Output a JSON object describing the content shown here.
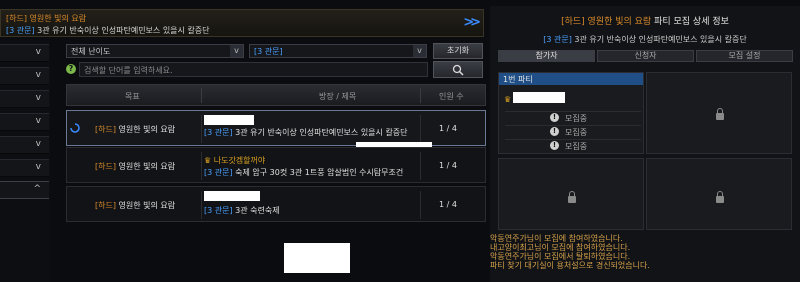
{
  "banner": {
    "difficulty": "[하드]",
    "dungeon": "영원한 빛의 요람",
    "tag": "[3 관문]",
    "description": "3관 유기 반숙이상 인성파탄예민보스 있을시 칼증단"
  },
  "filters": {
    "difficulty_select": "전체 난이도",
    "gate_select": "[3 관문]",
    "reset_button": "초기화",
    "search_placeholder": "검색할 단어를 입력하세요."
  },
  "list": {
    "columns": [
      "목표",
      "방장 / 제목",
      "인원 수"
    ],
    "rows": [
      {
        "difficulty": "[하드]",
        "target": "영원한 빛의 요람",
        "leader": "",
        "tag": "[3 관문]",
        "title": "3관 유기 반숙이상 인성파탄예민보스 있을시 칼증단",
        "count": "1 / 4"
      },
      {
        "difficulty": "[하드]",
        "target": "영원한 빛의 요람",
        "leader": "나도갓겜할꺼야",
        "tag": "[3 관문]",
        "title": "숙제 암구 30컷 3관 1트풍 암살범인 수시탐무조건",
        "count": "1 / 4"
      },
      {
        "difficulty": "[하드]",
        "target": "영원한 빛의 요람",
        "leader": "",
        "tag": "[3 관문]",
        "title": "3관 숙련숙제",
        "count": "1 / 4"
      }
    ]
  },
  "panel": {
    "title_hl": "[하드] 영원한 빛의 요람",
    "title_rest": "파티 모집 상세 정보",
    "sub_tag": "[3 관문]",
    "sub_text": "3관 유기 반숙이상 인성파탄예민보스 있을시 칼증단",
    "tabs": [
      "참가자",
      "신청자",
      "모집 설정"
    ],
    "party_label": "1번 파티",
    "recruiting": "모집중",
    "log": [
      "악동연주가님이 모집에 참여하였습니다.",
      "내고양이최고님이 모집에 참여하였습니다.",
      "악동연주가님이 모집에서 탈퇴하였습니다.",
      "파티 찾기 대기실이 용처설으로 경신되었습니다."
    ]
  }
}
